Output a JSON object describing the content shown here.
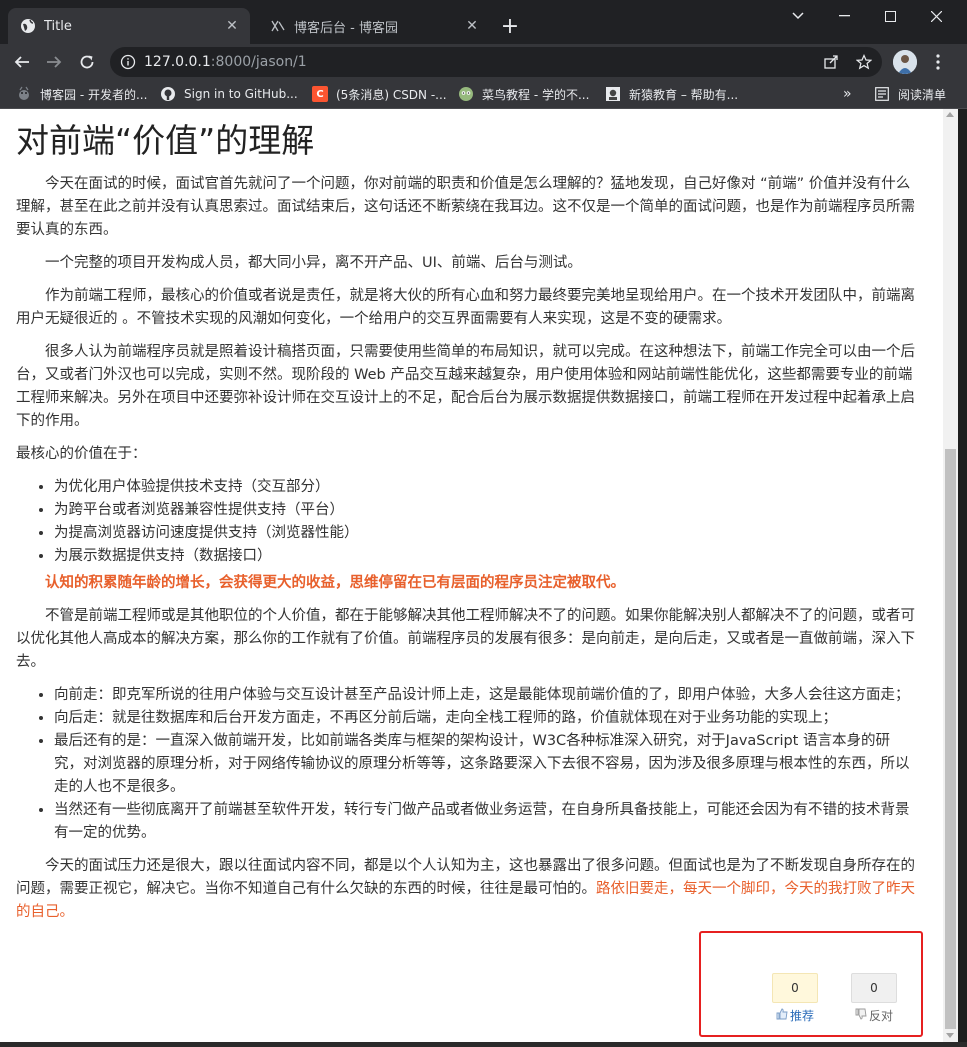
{
  "browser": {
    "tabs": [
      {
        "title": "Title",
        "active": true
      },
      {
        "title": "博客后台 - 博客园",
        "active": false
      }
    ],
    "url_host": "127.0.0.1",
    "url_path": ":8000/jason/1",
    "bookmarks": [
      {
        "label": "博客园 - 开发者的...",
        "icon": "cnblogs-icon"
      },
      {
        "label": "Sign in to GitHub...",
        "icon": "github-icon"
      },
      {
        "label": "(5条消息) CSDN -...",
        "icon": "csdn-icon"
      },
      {
        "label": "菜鸟教程 - 学的不...",
        "icon": "runoob-icon"
      },
      {
        "label": "新猿教育 – 帮助有...",
        "icon": "xinyuan-icon"
      }
    ],
    "reading_list": "阅读清单",
    "more_bookmarks": "»"
  },
  "article": {
    "title": "对前端“价值”的理解",
    "p1": "今天在面试的时候，面试官首先就问了一个问题，你对前端的职责和价值是怎么理解的？猛地发现，自己好像对 “前端” 价值并没有什么理解，甚至在此之前并没有认真思索过。面试结束后，这句话还不断萦绕在我耳边。这不仅是一个简单的面试问题，也是作为前端程序员所需要认真的东西。",
    "p2": "一个完整的项目开发构成人员，都大同小异，离不开产品、UI、前端、后台与测试。",
    "p3": "作为前端工程师，最核心的价值或者说是责任，就是将大伙的所有心血和努力最终要完美地呈现给用户。在一个技术开发团队中，前端离用户无疑很近的 。不管技术实现的风潮如何变化，一个给用户的交互界面需要有人来实现，这是不变的硬需求。",
    "p4": "很多人认为前端程序员就是照着设计稿搭页面，只需要使用些简单的布局知识，就可以完成。在这种想法下，前端工作完全可以由一个后台，又或者门外汉也可以完成，实则不然。现阶段的 Web 产品交互越来越复杂，用户使用体验和网站前端性能优化，这些都需要专业的前端工程师来解决。另外在项目中还要弥补设计师在交互设计上的不足，配合后台为展示数据提供数据接口，前端工程师在开发过程中起着承上启下的作用。",
    "core_label": "最核心的价值在于：",
    "core_list": [
      "为优化用户体验提供技术支持（交互部分）",
      "为跨平台或者浏览器兼容性提供支持（平台）",
      "为提高浏览器访问速度提供支持（浏览器性能）",
      "为展示数据提供支持（数据接口）"
    ],
    "emphasis": "认知的积累随年龄的增长，会获得更大的收益，思维停留在已有层面的程序员注定被取代。",
    "p5": "不管是前端工程师或是其他职位的个人价值，都在于能够解决其他工程师解决不了的问题。如果你能解决别人都解决不了的问题，或者可以优化其他人高成本的解决方案，那么你的工作就有了价值。前端程序员的发展有很多：是向前走，是向后走，又或者是一直做前端，深入下去。",
    "path_list": [
      "向前走：即克军所说的往用户体验与交互设计甚至产品设计师上走，这是最能体现前端价值的了，即用户体验，大多人会往这方面走；",
      "向后走：就是往数据库和后台开发方面走，不再区分前后端，走向全栈工程师的路，价值就体现在对于业务功能的实现上；",
      "最后还有的是：一直深入做前端开发，比如前端各类库与框架的架构设计，W3C各种标准深入研究，对于JavaScript 语言本身的研究，对浏览器的原理分析，对于网络传输协议的原理分析等等，这条路要深入下去很不容易，因为涉及很多原理与根本性的东西，所以走的人也不是很多。",
      "当然还有一些彻底离开了前端甚至软件开发，转行专门做产品或者做业务运营，在自身所具备技能上，可能还会因为有不错的技术背景有一定的优势。"
    ],
    "p6_main": "今天的面试压力还是很大，跟以往面试内容不同，都是以个人认知为主，这也暴露出了很多问题。但面试也是为了不断发现自身所存在的问题，需要正视它，解决它。当你不知道自己有什么欠缺的东西的时候，往往是最可怕的。",
    "p6_orange": "路依旧要走，每天一个脚印，今天的我打败了昨天的自己。"
  },
  "votes": {
    "digg_count": "0",
    "digg_label": "推荐",
    "bury_count": "0",
    "bury_label": "反对"
  },
  "colors": {
    "accent_orange": "#e8602c",
    "highlight_box": "#e62020"
  }
}
